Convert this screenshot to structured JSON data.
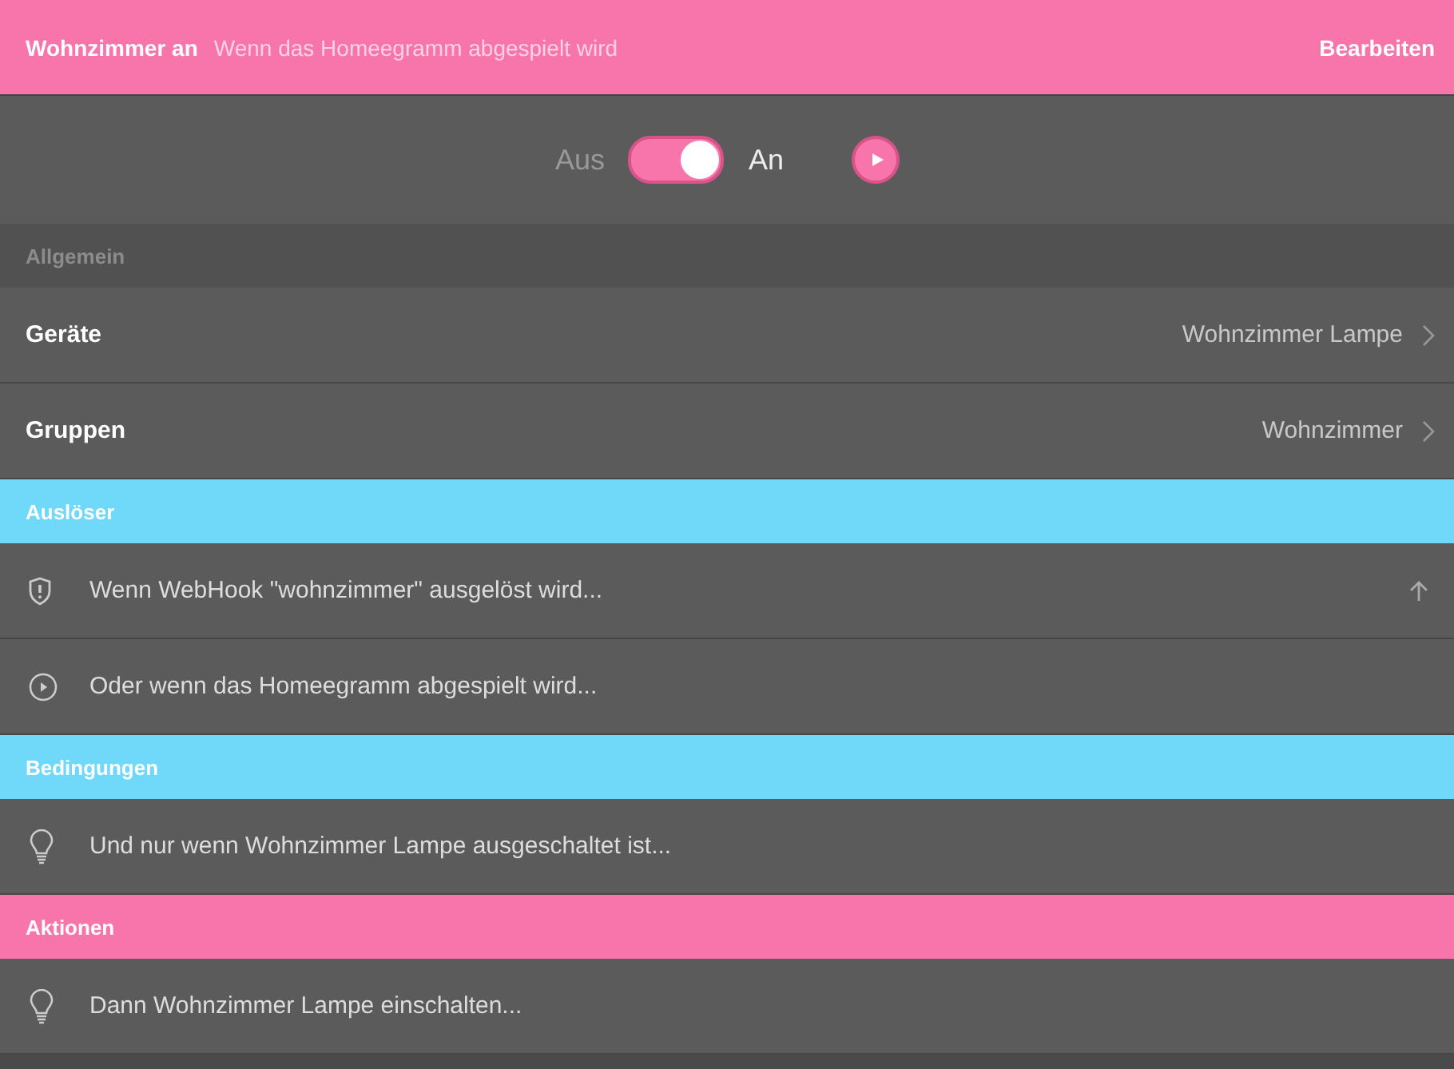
{
  "header": {
    "title": "Wohnzimmer an",
    "subtitle": "Wenn das Homeegramm abgespielt wird",
    "action": "Bearbeiten"
  },
  "switch": {
    "off_label": "Aus",
    "on_label": "An",
    "on": true
  },
  "sections": [
    {
      "title": "Allgemein",
      "color": "#515151",
      "rows": [
        {
          "kind": "setting",
          "label": "Geräte",
          "value": "Wohnzimmer Lampe"
        },
        {
          "kind": "setting",
          "label": "Gruppen",
          "value": "Wohnzimmer"
        }
      ]
    },
    {
      "title": "Auslöser",
      "color": "#70d8f8",
      "rows": [
        {
          "kind": "webhook",
          "label": "Wenn WebHook \"wohnzimmer\" ausgelöst wird...",
          "move_up": true
        },
        {
          "kind": "homeegram",
          "label": "Oder wenn das Homeegramm abgespielt wird...",
          "move_up": false
        }
      ]
    },
    {
      "title": "Bedingungen",
      "color": "#70d8f8",
      "rows": [
        {
          "kind": "device",
          "label": "Und nur wenn Wohnzimmer Lampe ausgeschaltet ist...",
          "move_up": false
        }
      ]
    },
    {
      "title": "Aktionen",
      "color": "#f775aa",
      "rows": [
        {
          "kind": "device",
          "label": "Dann Wohnzimmer Lampe einschalten...",
          "move_up": false
        }
      ]
    }
  ]
}
